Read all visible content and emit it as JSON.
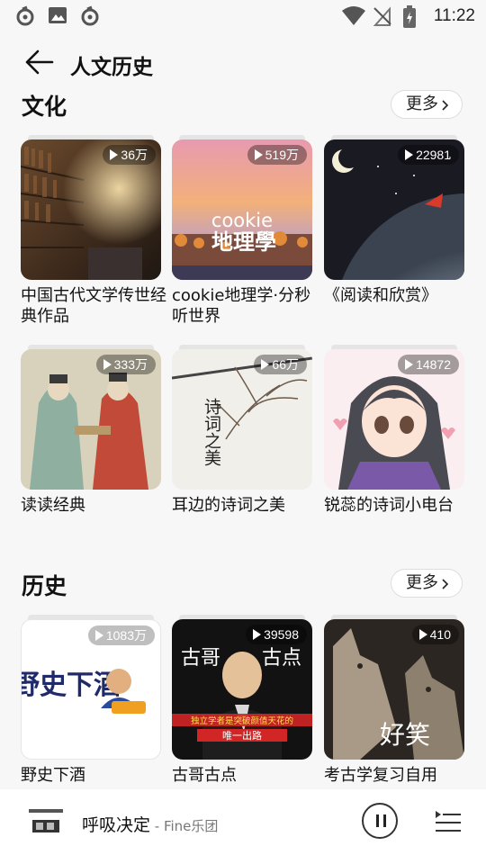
{
  "status_bar": {
    "time": "11:22"
  },
  "header": {
    "title": "人文历史"
  },
  "sections": [
    {
      "title": "文化",
      "more_label": "更多",
      "items": [
        {
          "title": "中国古代文学传世经典作品",
          "plays": "36万"
        },
        {
          "title": "cookie地理学·分秒听世界",
          "plays": "519万"
        },
        {
          "title": "《阅读和欣赏》",
          "plays": "22981"
        },
        {
          "title": "读读经典",
          "plays": "333万"
        },
        {
          "title": "耳边的诗词之美",
          "plays": "66万"
        },
        {
          "title": "锐蕊的诗词小电台",
          "plays": "14872"
        }
      ]
    },
    {
      "title": "历史",
      "more_label": "更多",
      "items": [
        {
          "title": "野史下酒",
          "plays": "1083万"
        },
        {
          "title": "古哥古点",
          "plays": "39598"
        },
        {
          "title": "考古学复习自用",
          "plays": "410"
        }
      ]
    }
  ],
  "cover_text": {
    "cookie": "cookie",
    "dilixue": "地理學",
    "shici": "诗词之美",
    "yeshi": "野史下酒",
    "gugegudian_left": "古哥",
    "gugegudian_right": "古点",
    "gugegudian_banner1": "独立学者是突破颜值天花的",
    "gugegudian_banner2": "唯一出路",
    "haoxiao": "好笑"
  },
  "now_playing": {
    "song": "呼吸决定",
    "artist": " - Fine乐团"
  },
  "colors": {
    "background": "#f7f7f7",
    "badge": "rgba(0,0,0,0.35)"
  }
}
